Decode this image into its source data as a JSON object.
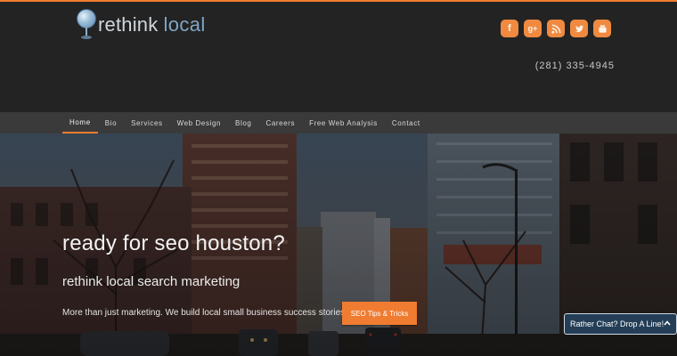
{
  "brand": {
    "name_part1": "rethink",
    "name_part2": "local",
    "accent_color": "#f07c31"
  },
  "header": {
    "phone": "(281) 335-4945",
    "social": [
      {
        "icon": "facebook-icon",
        "glyph": "f"
      },
      {
        "icon": "google-plus-icon",
        "glyph": "g+"
      },
      {
        "icon": "rss-icon",
        "glyph": ""
      },
      {
        "icon": "twitter-icon",
        "glyph": ""
      },
      {
        "icon": "youtube-icon",
        "glyph": ""
      }
    ]
  },
  "nav": {
    "items": [
      "Home",
      "Bio",
      "Services",
      "Web Design",
      "Blog",
      "Careers",
      "Free Web Analysis",
      "Contact"
    ],
    "active_index": 0
  },
  "hero": {
    "title": "ready for seo houston?",
    "subtitle": "rethink local search marketing",
    "text": "More than just marketing. We build local small business success stories!",
    "button_label": "SEO Tips & Tricks"
  },
  "chat": {
    "label": "Rather Chat? Drop A Line!",
    "icon": "chevron-up-icon"
  }
}
